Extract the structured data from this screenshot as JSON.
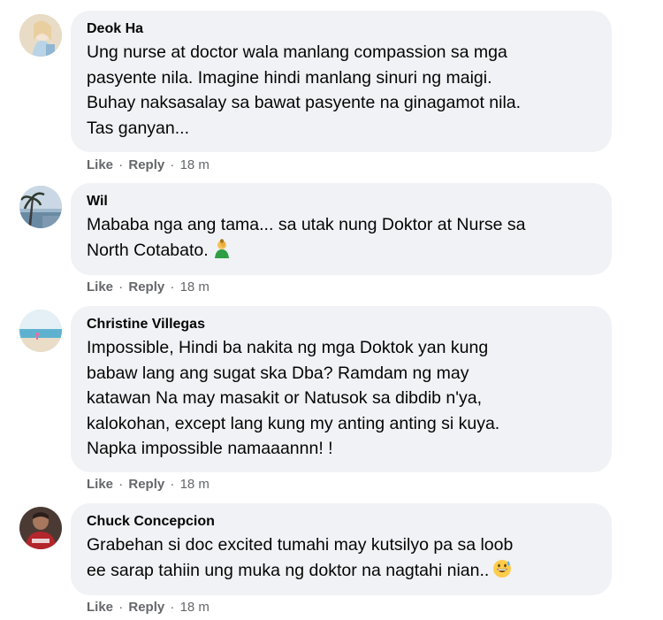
{
  "comments": [
    {
      "author": "Deok Ha",
      "text": "Ung nurse at doctor wala manlang compassion sa mga pasyente nila. Imagine hindi manlang sinuri ng maigi. Buhay naksasalay sa bawat pasyente na ginagamot nila. Tas ganyan...",
      "lines": [
        "Ung nurse at doctor wala manlang compassion sa mga",
        "pasyente nila. Imagine hindi manlang sinuri ng maigi.",
        "Buhay naksasalay sa bawat pasyente na ginagamot nila.",
        "Tas ganyan..."
      ],
      "like_label": "Like",
      "reply_label": "Reply",
      "time": "18 m"
    },
    {
      "author": "Wil",
      "lines": [
        "Mababa nga ang tama... sa utak nung Doktor at Nurse sa",
        "North Cotabato."
      ],
      "emoji": "person-facepalming-emoji",
      "like_label": "Like",
      "reply_label": "Reply",
      "time": "18 m"
    },
    {
      "author": "Christine Villegas",
      "lines": [
        "Impossible, Hindi ba nakita ng mga Doktok yan kung",
        "babaw lang ang sugat ska Dba? Ramdam ng may",
        "katawan Na may masakit or Natusok sa dibdib n'ya,",
        "kalokohan, except lang kung my anting anting si kuya.",
        "Napka impossible namaaannn! !"
      ],
      "like_label": "Like",
      "reply_label": "Reply",
      "time": "18 m"
    },
    {
      "author": "Chuck Concepcion",
      "lines": [
        "Grabehan si doc excited tumahi may kutsilyo pa sa loob",
        "ee sarap tahiin ung muka ng doktor na nagtahi nian.."
      ],
      "emoji": "grinning-sweat-emoji",
      "like_label": "Like",
      "reply_label": "Reply",
      "time": "18 m"
    }
  ],
  "separator": "·",
  "colors": {
    "bubble_bg": "#f0f2f5",
    "meta_text": "#65676b",
    "text": "#050505"
  }
}
